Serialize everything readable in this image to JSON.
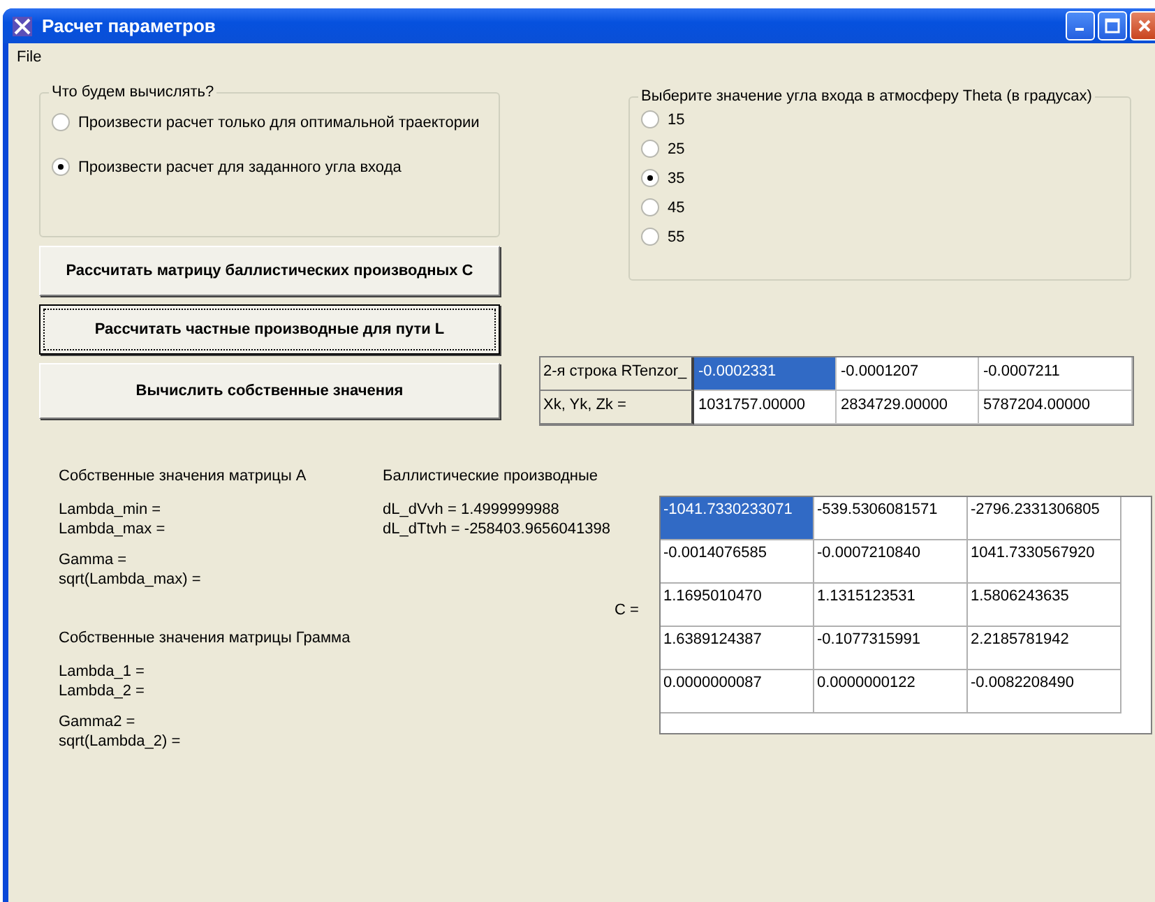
{
  "window": {
    "title": "Расчет параметров"
  },
  "menu": [
    {
      "label": "File"
    }
  ],
  "mode_group": {
    "title": "Что будем вычислять?",
    "options": [
      {
        "label": "Произвести расчет только для оптимальной траектории",
        "selected": false
      },
      {
        "label": "Произвести расчет для заданного угла входа",
        "selected": true
      }
    ]
  },
  "buttons": [
    {
      "label": "Рассчитать матрицу баллистических производных C",
      "focused": false
    },
    {
      "label": "Рассчитать частные производные для пути L",
      "focused": true
    },
    {
      "label": "Вычислить собственные значения",
      "focused": false
    }
  ],
  "theta_group": {
    "title": "Выберите значение угла входа в атмосферу Theta (в градусах)",
    "options": [
      {
        "label": "15",
        "selected": false
      },
      {
        "label": "25",
        "selected": false
      },
      {
        "label": "35",
        "selected": true
      },
      {
        "label": "45",
        "selected": false
      },
      {
        "label": "55",
        "selected": false
      }
    ]
  },
  "rtensor_table": {
    "rows": [
      {
        "header": "2-я строка RTenzor_",
        "cells": [
          {
            "text": "-0.0002331",
            "selected": true
          },
          {
            "text": "-0.0001207",
            "selected": false
          },
          {
            "text": "-0.0007211",
            "selected": false
          }
        ]
      },
      {
        "header": "Xk, Yk, Zk =",
        "cells": [
          {
            "text": "1031757.00000",
            "selected": false
          },
          {
            "text": "2834729.00000",
            "selected": false
          },
          {
            "text": "5787204.00000",
            "selected": false
          }
        ]
      }
    ]
  },
  "eigen_a": {
    "title": "Собственные значения матрицы A",
    "blocks": [
      [
        "Lambda_min =",
        "Lambda_max ="
      ],
      [
        "Gamma =",
        "sqrt(Lambda_max) ="
      ]
    ]
  },
  "eigen_gram": {
    "title": "Собственные значения матрицы Грамма",
    "blocks": [
      [
        "Lambda_1 =",
        "Lambda_2 ="
      ],
      [
        "Gamma2 =",
        "sqrt(Lambda_2) ="
      ]
    ]
  },
  "ballistic": {
    "title": "Баллистические производные",
    "lines": [
      "dL_dVvh = 1.4999999988",
      "dL_dTtvh = -258403.9656041398"
    ]
  },
  "c_matrix": {
    "label": "C =",
    "rows": [
      [
        {
          "text": "-1041.7330233071",
          "selected": true
        },
        {
          "text": "-539.5306081571",
          "selected": false
        },
        {
          "text": "-2796.2331306805",
          "selected": false
        }
      ],
      [
        {
          "text": "-0.0014076585",
          "selected": false
        },
        {
          "text": "-0.0007210840",
          "selected": false
        },
        {
          "text": "1041.7330567920",
          "selected": false
        }
      ],
      [
        {
          "text": "1.1695010470",
          "selected": false
        },
        {
          "text": "1.1315123531",
          "selected": false
        },
        {
          "text": "1.5806243635",
          "selected": false
        }
      ],
      [
        {
          "text": "1.6389124387",
          "selected": false
        },
        {
          "text": "-0.1077315991",
          "selected": false
        },
        {
          "text": "2.2185781942",
          "selected": false
        }
      ],
      [
        {
          "text": "0.0000000087",
          "selected": false
        },
        {
          "text": "0.0000000122",
          "selected": false
        },
        {
          "text": "-0.0082208490",
          "selected": false
        }
      ]
    ]
  }
}
